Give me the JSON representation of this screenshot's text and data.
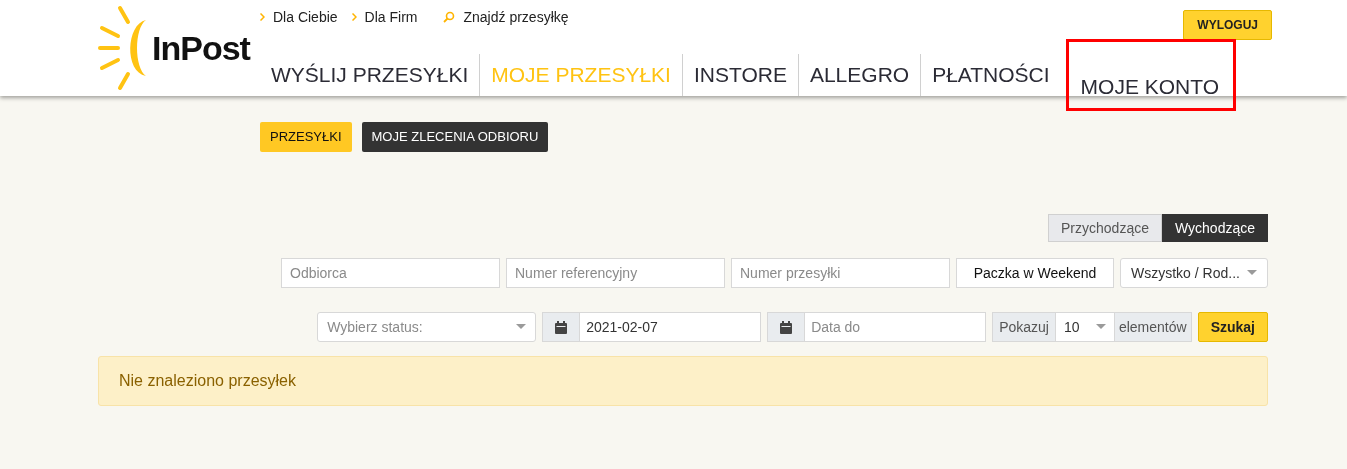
{
  "logo": {
    "text": "InPost"
  },
  "top_links": [
    {
      "label": "Dla Ciebie",
      "kind": "chevron"
    },
    {
      "label": "Dla Firm",
      "kind": "chevron"
    },
    {
      "label": "Znajdź przesyłkę",
      "kind": "search"
    }
  ],
  "logout_button": "WYLOGUJ",
  "nav": [
    {
      "label": "WYŚLIJ PRZESYŁKI",
      "selected": false,
      "highlighted": false
    },
    {
      "label": "MOJE PRZESYŁKI",
      "selected": true,
      "highlighted": false
    },
    {
      "label": "INSTORE",
      "selected": false,
      "highlighted": false
    },
    {
      "label": "ALLEGRO",
      "selected": false,
      "highlighted": false
    },
    {
      "label": "PŁATNOŚCI",
      "selected": false,
      "highlighted": false
    },
    {
      "label": "MOJE KONTO",
      "selected": false,
      "highlighted": true
    }
  ],
  "subtabs": [
    {
      "label": "PRZESYŁKI",
      "selected": true
    },
    {
      "label": "MOJE ZLECENIA ODBIORU",
      "selected": false
    }
  ],
  "direction": [
    {
      "label": "Przychodzące",
      "selected": false
    },
    {
      "label": "Wychodzące",
      "selected": true
    }
  ],
  "filters": {
    "recipient": {
      "placeholder": "Odbiorca"
    },
    "reference": {
      "placeholder": "Numer referencyjny"
    },
    "parcel_number": {
      "placeholder": "Numer przesyłki"
    },
    "weekend_button": "Paczka w Weekend",
    "type_select": "Wszystko / Rod...",
    "status_select": {
      "placeholder": "Wybierz status:"
    },
    "date_from": {
      "value": "2021-02-07"
    },
    "date_to": {
      "placeholder": "Data do"
    },
    "show_label": "Pokazuj",
    "per_page": "10",
    "per_page_suffix": "elementów",
    "search_button": "Szukaj"
  },
  "alert": "Nie znaleziono przesyłek"
}
